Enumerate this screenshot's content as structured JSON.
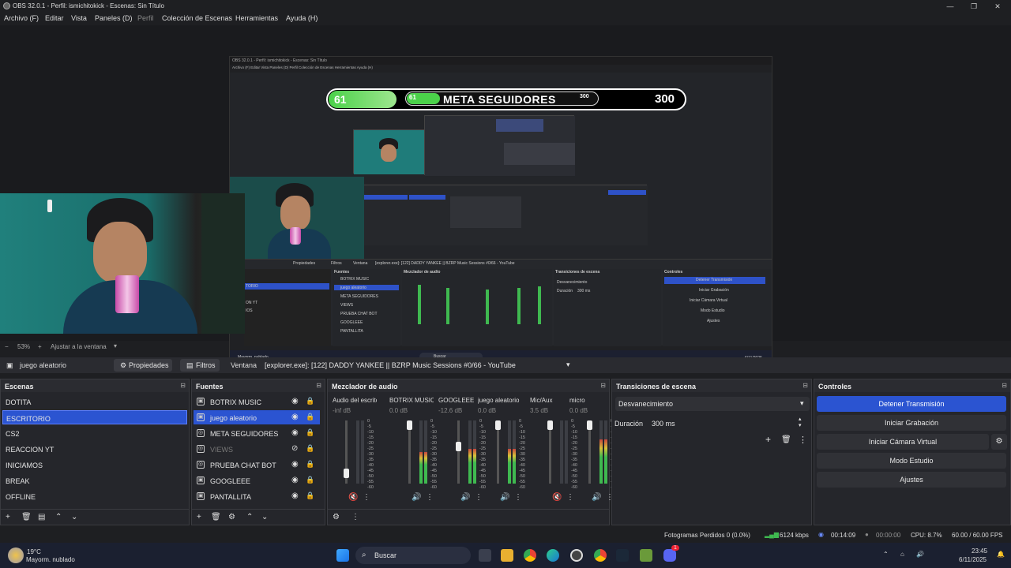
{
  "window": {
    "title": "OBS 32.0.1 - Perfil: ismichitokick - Escenas: Sin Título",
    "controls": [
      "—",
      "❐",
      "✕"
    ]
  },
  "menu": [
    "Archivo (F)",
    "Editar",
    "Vista",
    "Paneles (D)",
    "Perfil",
    "Colección de Escenas",
    "Herramientas",
    "Ayuda (H)"
  ],
  "preview": {
    "nested_title": "OBS 32.0.1 - Perfil: ismichitokick - Escenas: Sin Título",
    "nested_menu": "Archivo (F)   Editar   Vista   Paneles (D)   Perfil   Colección de Escenas   Herramientas   Ayuda (H)",
    "goal": {
      "current": "61",
      "label": "META SEGUIDORES",
      "target": "300",
      "inner_current": "61",
      "inner_target": "300",
      "progress": 0.2
    },
    "nested_sources": [
      "BOTRIX MUSIC",
      "juego aleatorio",
      "META SEGUIDORES",
      "VIEWS",
      "PRUEBA CHAT BOT",
      "GOOGLEEE",
      "PANTALLITA"
    ],
    "nested_scene_rows": [
      "TORIO",
      "ON YT",
      "IOS"
    ],
    "nested_props": "Propiedades",
    "nested_filters": "Filtros",
    "nested_window": "Ventana",
    "nested_window_value": "[explorer.exe]: [122] DADDY YANKEE || BZRP Music Sessions #0/66 - YouTube",
    "nested_headers": [
      "Fuentes",
      "Mezclador de audio",
      "Transiciones de escena",
      "Controles"
    ],
    "nested_controls": [
      "Detener Transmisión",
      "Iniciar Grabación",
      "Iniciar Cámara Virtual",
      "Modo Estudio",
      "Ajustes"
    ],
    "nested_transition": "Desvanecimiento",
    "nested_duration_label": "Duración",
    "nested_duration": "300 ms",
    "nested_search": "Buscar",
    "nested_weather": "Mayorm. nublado",
    "nested_date": "6/11/2025"
  },
  "zoom": {
    "minus": "−",
    "value": "53%",
    "plus": "+",
    "fit": "Ajustar a la ventana"
  },
  "source_bar": {
    "selected": "juego aleatorio",
    "properties": "Propiedades",
    "filters": "Filtros",
    "window_label": "Ventana",
    "window_value": "[explorer.exe]: [122] DADDY YANKEE || BZRP Music Sessions #0/66 - YouTube"
  },
  "scenes": {
    "header": "Escenas",
    "items": [
      "DOTITA",
      "ESCRITORIO",
      "CS2",
      "REACCION YT",
      "INICIAMOS",
      "BREAK",
      "OFFLINE"
    ],
    "selected_index": 1
  },
  "sources": {
    "header": "Fuentes",
    "items": [
      {
        "name": "BOTRIX MUSIC",
        "icon": "window-icon",
        "visible": true,
        "dim": false
      },
      {
        "name": "juego aleatorio",
        "icon": "window-icon",
        "visible": true,
        "dim": false
      },
      {
        "name": "META SEGUIDORES",
        "icon": "globe-icon",
        "visible": true,
        "dim": false
      },
      {
        "name": "VIEWS",
        "icon": "globe-icon",
        "visible": false,
        "dim": true
      },
      {
        "name": "PRUEBA CHAT BOT",
        "icon": "globe-icon",
        "visible": true,
        "dim": false
      },
      {
        "name": "GOOGLEEE",
        "icon": "window-icon",
        "visible": true,
        "dim": false
      },
      {
        "name": "PANTALLITA",
        "icon": "window-icon",
        "visible": true,
        "dim": false
      }
    ],
    "selected_index": 1
  },
  "mixer": {
    "header": "Mezclador de audio",
    "channels": [
      {
        "name": "Audio del escritorio",
        "db": "-inf dB",
        "level": 0,
        "fader": 0.1,
        "muted": true
      },
      {
        "name": "BOTRIX MUSIC",
        "db": "0.0 dB",
        "level": 0.5,
        "fader": 1.0,
        "muted": false
      },
      {
        "name": "GOOGLEEE",
        "db": "-12.6 dB",
        "level": 0.55,
        "fader": 0.6,
        "muted": false
      },
      {
        "name": "juego aleatorio",
        "db": "0.0 dB",
        "level": 0.55,
        "fader": 1.0,
        "muted": false
      },
      {
        "name": "Mic/Aux",
        "db": "3.5 dB",
        "level": 0,
        "fader": 1.0,
        "muted": true
      },
      {
        "name": "micro",
        "db": "0.0 dB",
        "level": 0.7,
        "fader": 1.0,
        "muted": false
      }
    ],
    "ticks": [
      "0",
      "-5",
      "-10",
      "-15",
      "-20",
      "-25",
      "-30",
      "-35",
      "-40",
      "-45",
      "-50",
      "-55",
      "-60"
    ]
  },
  "transitions": {
    "header": "Transiciones de escena",
    "selected": "Desvanecimiento",
    "duration_label": "Duración",
    "duration": "300 ms"
  },
  "controls": {
    "header": "Controles",
    "stream": "Detener Transmisión",
    "record": "Iniciar Grabación",
    "virtualcam": "Iniciar Cámara Virtual",
    "studio": "Modo Estudio",
    "settings": "Ajustes"
  },
  "status": {
    "dropped": "Fotogramas Perdidos 0 (0.0%)",
    "bitrate": "6124 kbps",
    "live_time": "00:14:09",
    "rec_time": "00:00:00",
    "cpu": "CPU: 8.7%",
    "fps": "60.00 / 60.00 FPS"
  },
  "taskbar": {
    "temp": "19°C",
    "weather": "Mayorm. nublado",
    "search": "Buscar",
    "time": "23:45",
    "date": "6/11/2025",
    "notification_count": "1"
  },
  "colors": {
    "accent": "#2b54d1",
    "meter_green": "#3fb950",
    "goal_green": "#4bd14a"
  }
}
